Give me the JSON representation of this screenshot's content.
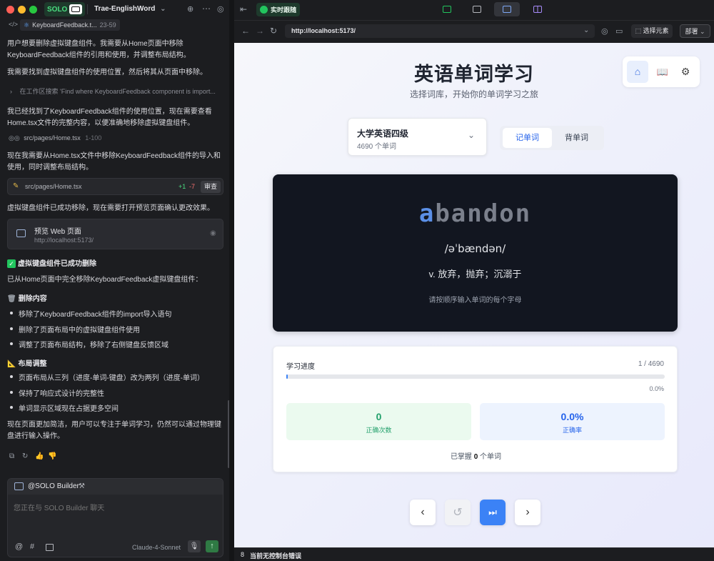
{
  "window": {
    "solo_badge": "SOLO",
    "project_name": "Trae-EnglishWord",
    "tabs": {
      "live_follow": "实时跟随"
    }
  },
  "context_chip": {
    "file": "KeyboardFeedback.t...",
    "range": "23-59"
  },
  "chat": {
    "p1": "用户想要删除虚拟键盘组件。我需要从Home页面中移除KeyboardFeedback组件的引用和使用，并调整布局结构。",
    "p2": "我需要找到虚拟键盘组件的使用位置，然后将其从页面中移除。",
    "search": "在工作区搜索 'Find where KeyboardFeedback component is import...",
    "p3": "我已经找到了KeyboardFeedback组件的使用位置，现在需要查看Home.tsx文件的完整内容，以便准确地移除虚拟键盘组件。",
    "view_file": "src/pages/Home.tsx",
    "view_range": "1-100",
    "p4": "现在我需要从Home.tsx文件中移除KeyboardFeedback组件的导入和使用，同时调整布局结构。",
    "edit_file": "src/pages/Home.tsx",
    "edit_add": "+1",
    "edit_del": "-7",
    "review_label": "审查",
    "p5": "虚拟键盘组件已成功移除，现在需要打开预览页面确认更改效果。",
    "preview_title": "预览 Web 页面",
    "preview_url": "http://localhost:5173/",
    "done_title": "虚拟键盘组件已成功删除",
    "done_intro": "已从Home页面中完全移除KeyboardFeedback虚拟键盘组件：",
    "sec1_title": "删除内容",
    "sec1_items": [
      "移除了KeyboardFeedback组件的import导入语句",
      "删除了页面布局中的虚拟键盘组件使用",
      "调整了页面布局结构，移除了右侧键盘反馈区域"
    ],
    "sec2_title": "布局调整",
    "sec2_items": [
      "页面布局从三列（进度-单词-键盘）改为两列（进度-单词）",
      "保持了响应式设计的完整性",
      "单词显示区域现在占据更多空间"
    ],
    "p6": "现在页面更加简洁，用户可以专注于单词学习，仍然可以通过物理键盘进行输入操作。"
  },
  "composer": {
    "agent": "@SOLO Builder",
    "placeholder": "您正在与 SOLO Builder 聊天",
    "model": "Claude-4-Sonnet"
  },
  "browser": {
    "url": "http://localhost:5173/",
    "select_element": "选择元素",
    "deploy": "部署"
  },
  "app": {
    "title": "英语单词学习",
    "subtitle": "选择词库，开始你的单词学习之旅",
    "dict_name": "大学英语四级",
    "dict_count": "4690 个单词",
    "mode_tabs": [
      "记单词",
      "背单词"
    ],
    "word_first": "a",
    "word_rest": "bandon",
    "phonetic": "/əˈbændən/",
    "definition": "v. 放弃，抛弃；沉溺于",
    "hint": "请按顺序输入单词的每个字母",
    "progress_label": "学习进度",
    "progress_count": "1 / 4690",
    "progress_fraction": 0.0002,
    "progress_pct": "0.0%",
    "correct_value": "0",
    "correct_label": "正确次数",
    "accuracy_value": "0.0%",
    "accuracy_label": "正确率",
    "mastered_prefix": "已掌握 ",
    "mastered_count": "0",
    "mastered_suffix": " 个单词"
  },
  "console": {
    "status": "当前无控制台错误"
  },
  "colors": {
    "accent": "#3b82f6",
    "green": "#22a06b",
    "solo_green": "#1f9d55"
  }
}
